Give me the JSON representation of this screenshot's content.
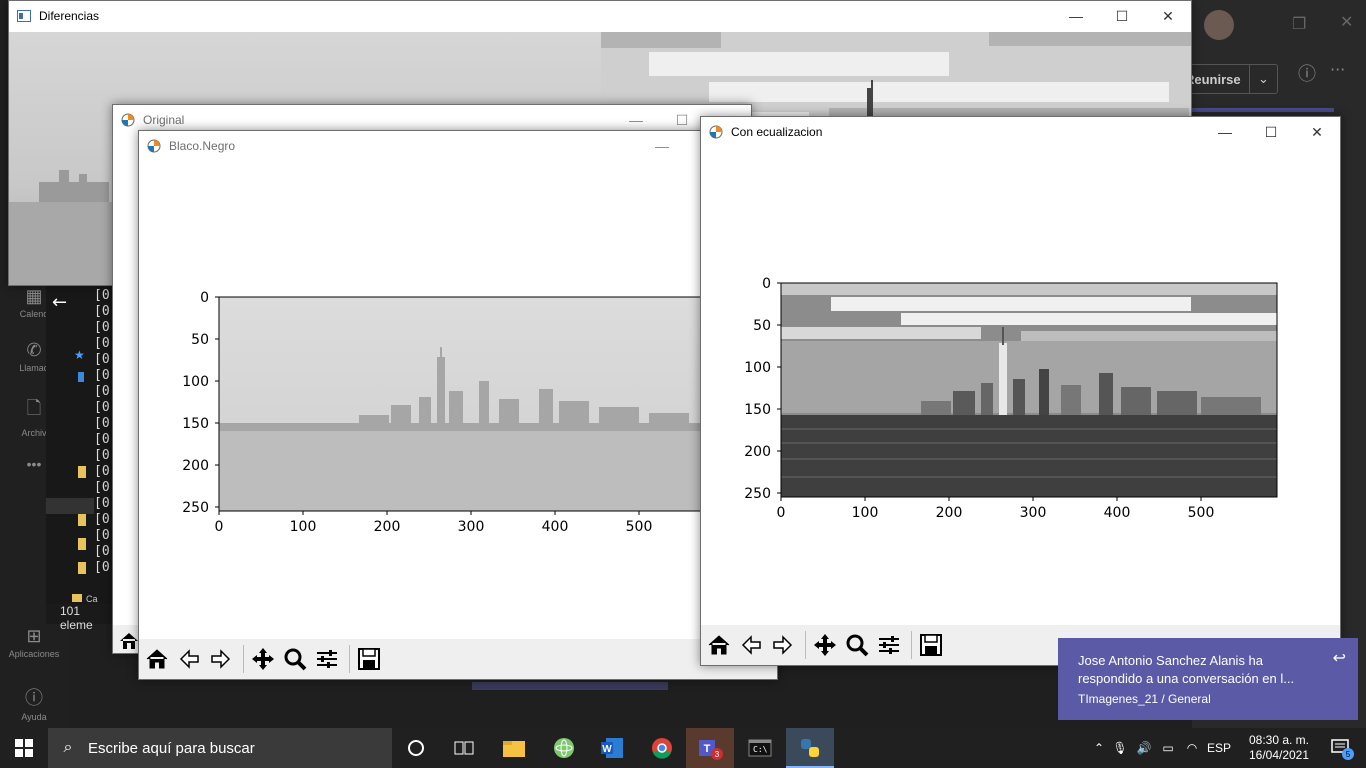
{
  "teams": {
    "rail": [
      {
        "label": "Calend",
        "icon": "calendar-icon"
      },
      {
        "label": "Llamad",
        "icon": "phone-icon"
      },
      {
        "label": "Archiv",
        "icon": "file-icon"
      },
      {
        "label": "...",
        "icon": "more-icon"
      },
      {
        "label": "Aplicaciones",
        "icon": "apps-icon"
      },
      {
        "label": "Ayuda",
        "icon": "help-icon"
      }
    ],
    "join_label": "Reunirse",
    "console_lines": [
      "[0",
      "[0",
      "[0",
      "[0",
      "[0",
      "[0",
      "[0",
      "[0",
      "[0",
      "[0",
      "[0",
      "[0",
      "[0",
      "[0",
      "[0",
      "[0",
      "[0",
      "[0"
    ],
    "explorer_count": "101 eleme",
    "explorer_folder": "Ca"
  },
  "windows": {
    "diferencias": {
      "title": "Diferencias"
    },
    "original": {
      "title": "Original"
    },
    "blanco": {
      "title": "Blaco.Negro"
    },
    "ecualizacion": {
      "title": "Con ecualizacion"
    }
  },
  "controls": {
    "minimize": "—",
    "maximize": "☐",
    "close": "✕"
  },
  "plot_blanco": {
    "xticks": [
      "0",
      "100",
      "200",
      "300",
      "400",
      "500"
    ],
    "yticks": [
      "0",
      "50",
      "100",
      "150",
      "200",
      "250"
    ]
  },
  "plot_ecual": {
    "xticks": [
      "0",
      "100",
      "200",
      "300",
      "400",
      "500"
    ],
    "yticks": [
      "0",
      "50",
      "100",
      "150",
      "200",
      "250"
    ]
  },
  "notification": {
    "text": "Jose Antonio Sanchez Alanis ha respondido a una conversación en l...",
    "sub": "TImagenes_21 / General"
  },
  "taskbar": {
    "search_placeholder": "Escribe aquí para buscar",
    "teams_badge": "3",
    "lang": "ESP",
    "time": "08:30 a. m.",
    "date": "16/04/2021",
    "notif_count": "5"
  }
}
